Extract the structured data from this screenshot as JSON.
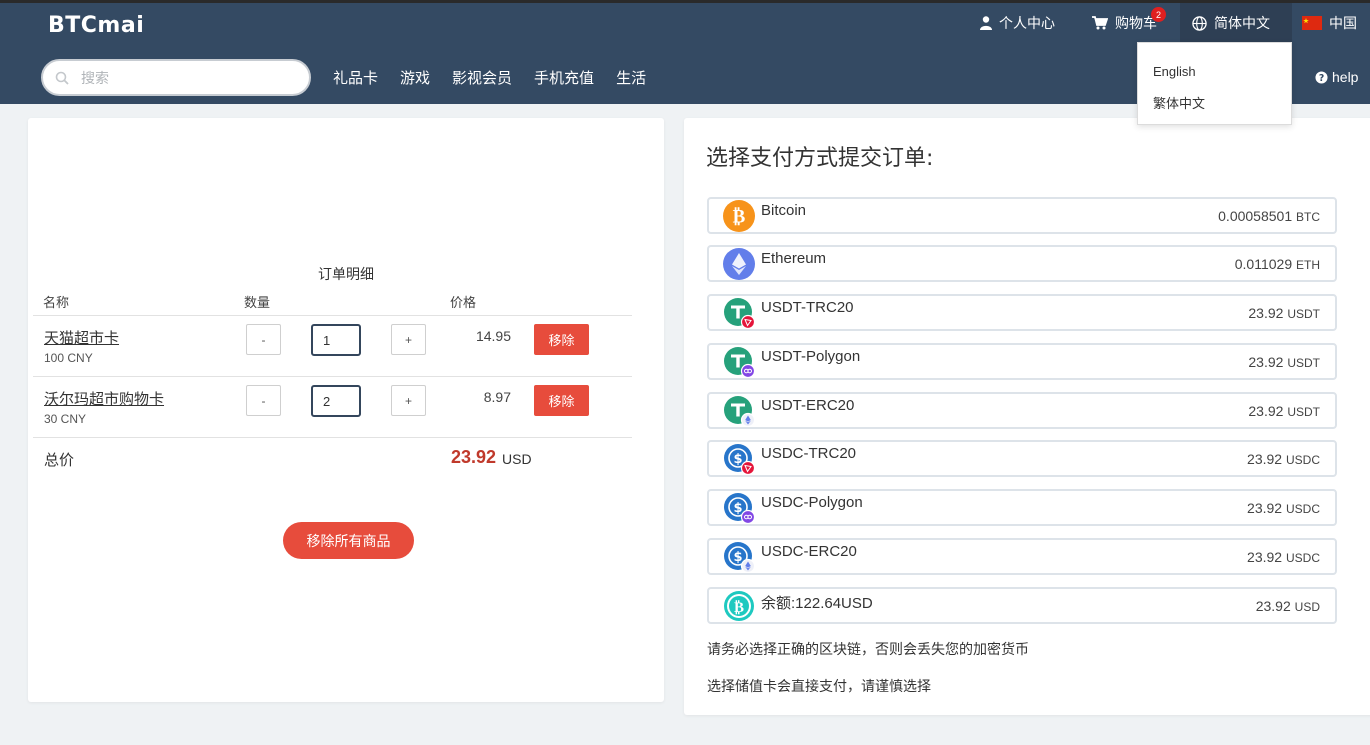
{
  "header": {
    "logo": "BTCmai",
    "account": "个人中心",
    "cart": "购物车",
    "cart_count": "2",
    "language": "简体中文",
    "region": "中国",
    "search_placeholder": "搜索",
    "categories": [
      "礼品卡",
      "游戏",
      "影视会员",
      "手机充值",
      "生活"
    ],
    "help": "help"
  },
  "language_menu": [
    "English",
    "繁体中文"
  ],
  "cart": {
    "title": "订单明细",
    "col_name": "名称",
    "col_qty": "数量",
    "col_price": "价格",
    "items": [
      {
        "name": "天猫超市卡",
        "sub": "100 CNY",
        "qty": "1",
        "price": "14.95"
      },
      {
        "name": "沃尔玛超市购物卡",
        "sub": "30 CNY",
        "qty": "2",
        "price": "8.97"
      }
    ],
    "minus": "-",
    "plus": "+",
    "remove": "移除",
    "total_label": "总价",
    "total": "23.92",
    "total_currency": "USD",
    "clear_all": "移除所有商品"
  },
  "payment": {
    "title": "选择支付方式提交订单:",
    "options": [
      {
        "name": "Bitcoin",
        "amount": "0.00058501",
        "unit": "BTC",
        "icon": "bitcoin-icon"
      },
      {
        "name": "Ethereum",
        "amount": "0.011029",
        "unit": "ETH",
        "icon": "ethereum-icon"
      },
      {
        "name": "USDT-TRC20",
        "amount": "23.92",
        "unit": "USDT",
        "icon": "tether-tron-icon"
      },
      {
        "name": "USDT-Polygon",
        "amount": "23.92",
        "unit": "USDT",
        "icon": "tether-polygon-icon"
      },
      {
        "name": "USDT-ERC20",
        "amount": "23.92",
        "unit": "USDT",
        "icon": "tether-ethereum-icon"
      },
      {
        "name": "USDC-TRC20",
        "amount": "23.92",
        "unit": "USDC",
        "icon": "usdc-tron-icon"
      },
      {
        "name": "USDC-Polygon",
        "amount": "23.92",
        "unit": "USDC",
        "icon": "usdc-polygon-icon"
      },
      {
        "name": "USDC-ERC20",
        "amount": "23.92",
        "unit": "USDC",
        "icon": "usdc-ethereum-icon"
      },
      {
        "name": "余额:122.64USD",
        "amount": "23.92",
        "unit": "USD",
        "icon": "balance-bitcoin-icon"
      }
    ],
    "note1": "请务必选择正确的区块链，否则会丢失您的加密货币",
    "note2": "选择储值卡会直接支付，请谨慎选择"
  },
  "colors": {
    "header_bg": "#344a63",
    "danger": "#e74c3c",
    "total": "#c0392b"
  }
}
